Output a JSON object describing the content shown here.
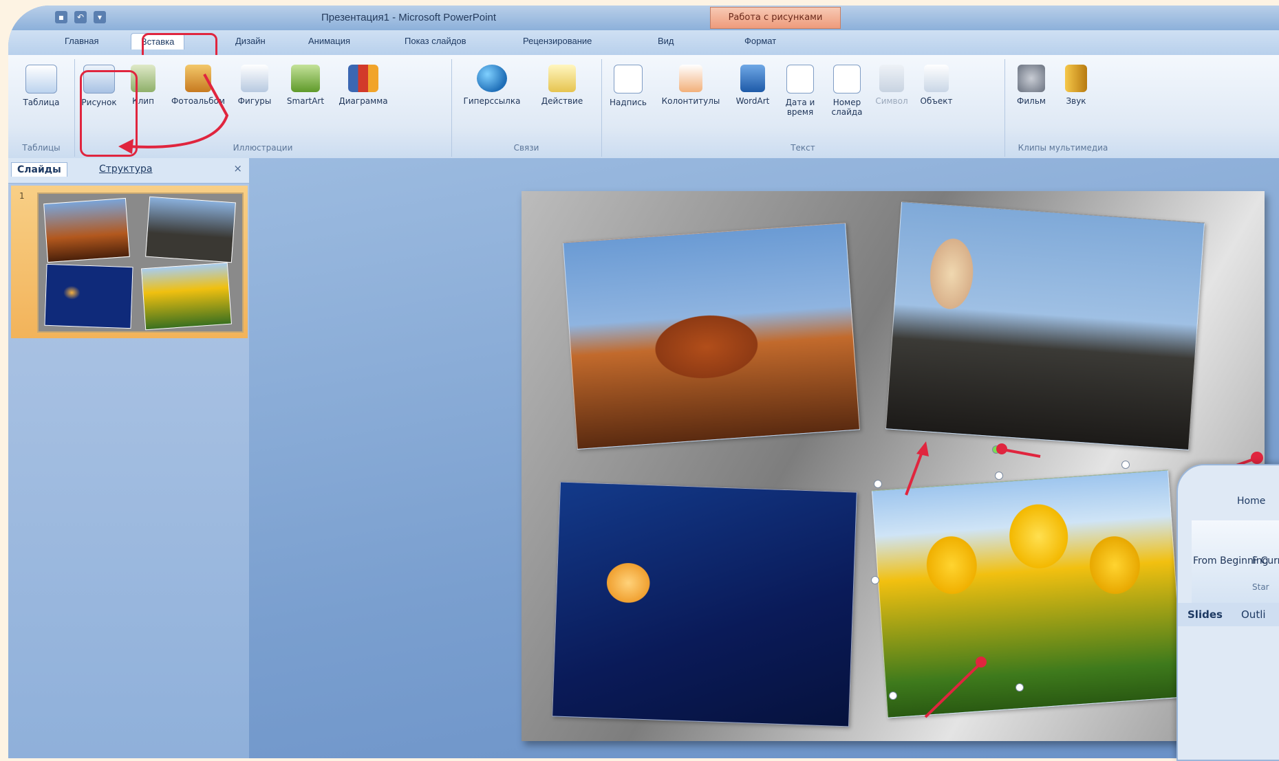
{
  "window": {
    "title": "Презентация1 - Microsoft PowerPoint",
    "context_title": "Работа с рисунками"
  },
  "tabs": [
    {
      "label": "Главная"
    },
    {
      "label": "Вставка",
      "active": true
    },
    {
      "label": "Дизайн"
    },
    {
      "label": "Анимация"
    },
    {
      "label": "Показ слайдов"
    },
    {
      "label": "Рецензирование"
    },
    {
      "label": "Вид"
    },
    {
      "label": "Формат"
    }
  ],
  "ribbon": {
    "groups": [
      {
        "label": "Таблицы",
        "buttons": [
          "Таблица"
        ]
      },
      {
        "label": "Иллюстрации",
        "buttons": [
          "Рисунок",
          "Клип",
          "Фотоальбом",
          "Фигуры",
          "SmartArt",
          "Диаграмма"
        ]
      },
      {
        "label": "Связи",
        "buttons": [
          "Гиперссылка",
          "Действие"
        ]
      },
      {
        "label": "Текст",
        "buttons": [
          "Надпись",
          "Колонтитулы",
          "WordArt",
          "Дата и время",
          "Номер слайда",
          "Символ",
          "Объект"
        ]
      },
      {
        "label": "Клипы мультимедиа",
        "buttons": [
          "Фильм",
          "Звук"
        ]
      }
    ]
  },
  "slides_pane": {
    "tab_slides": "Слайды",
    "tab_outline": "Структура",
    "close": "×",
    "thumb_number": "1"
  },
  "inset": {
    "tab_home": "Home",
    "from_beginning": "From Beginning",
    "from_current": "F Curr",
    "start_group": "Star",
    "slides_tab": "Slides",
    "outline_tab": "Outli"
  },
  "colors": {
    "highlight": "#e0253e",
    "thumb_bg": "#f2b35a"
  }
}
